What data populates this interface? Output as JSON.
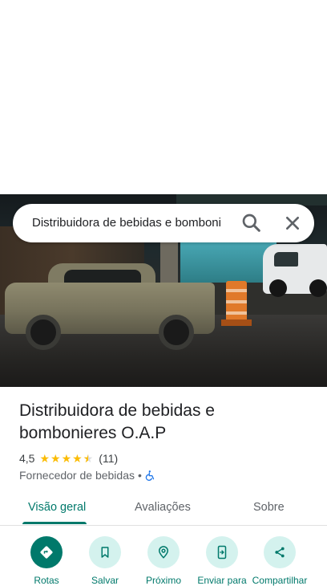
{
  "search": {
    "query": "Distribuidora de bebidas e bomboni"
  },
  "place": {
    "name": "Distribuidora de bebidas e bombonieres O.A.P",
    "rating": "4,5",
    "rating_value": 4.5,
    "reviews_count": "(11)",
    "category": "Fornecedor de bebidas",
    "separator": "•"
  },
  "tabs": [
    {
      "label": "Visão geral",
      "active": true
    },
    {
      "label": "Avaliações",
      "active": false
    },
    {
      "label": "Sobre",
      "active": false
    }
  ],
  "actions": [
    {
      "label": "Rotas",
      "icon": "directions-icon"
    },
    {
      "label": "Salvar",
      "icon": "bookmark-icon"
    },
    {
      "label": "Próximo",
      "icon": "nearby-icon"
    },
    {
      "label": "Enviar para",
      "icon": "send-to-phone-icon"
    },
    {
      "label": "Compartilhar",
      "icon": "share-icon"
    }
  ],
  "colors": {
    "accent": "#00796b",
    "accent_light": "#d4f2ee",
    "star": "#fbbc04",
    "accessibility": "#1a73e8"
  }
}
